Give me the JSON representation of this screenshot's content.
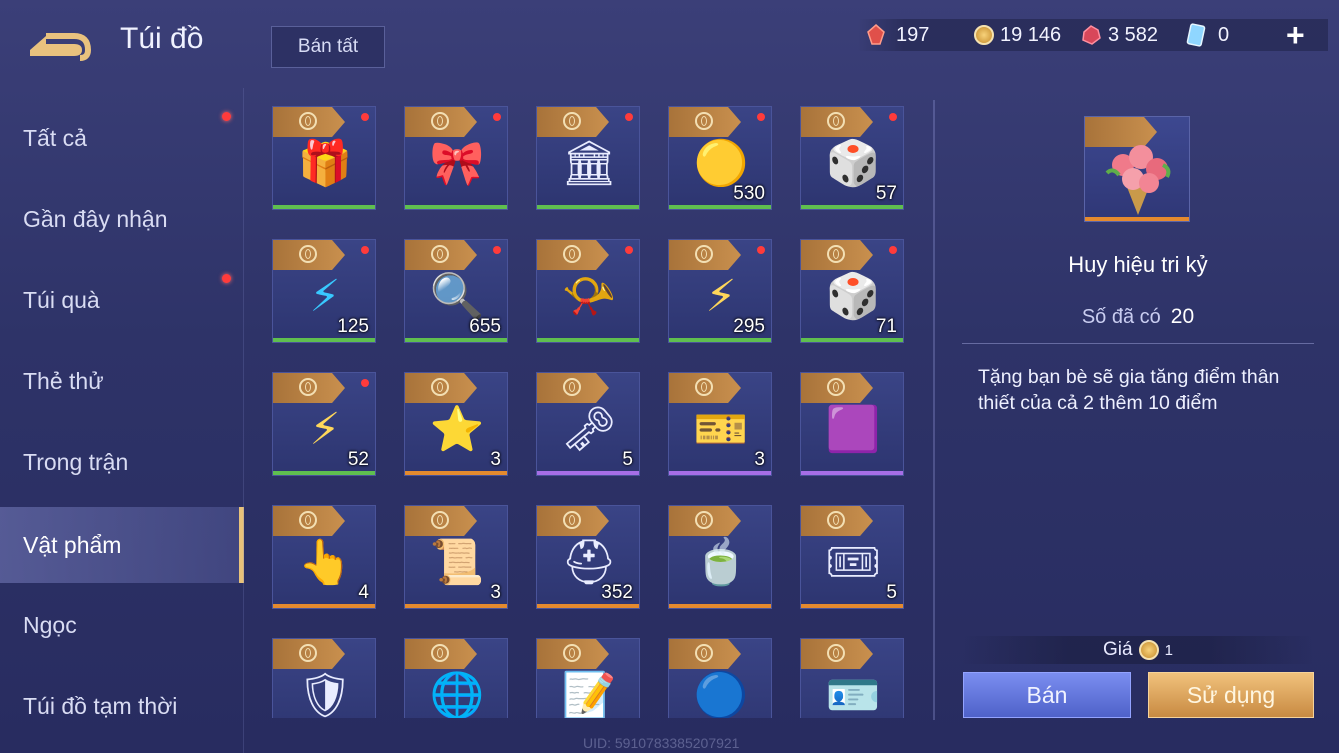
{
  "header": {
    "title": "Túi đồ",
    "sell_all": "Bán tất"
  },
  "currencies": [
    {
      "icon": "red-gem-icon",
      "value": "197"
    },
    {
      "icon": "gold-coin-icon",
      "value": "19 146"
    },
    {
      "icon": "ruby-icon",
      "value": "3 582"
    },
    {
      "icon": "blue-voucher-icon",
      "value": "0"
    }
  ],
  "sidebar": {
    "items": [
      {
        "label": "Tất cả",
        "dot": true
      },
      {
        "label": "Gần đây nhận",
        "dot": false
      },
      {
        "label": "Túi quà",
        "dot": true
      },
      {
        "label": "Thẻ thử",
        "dot": false
      },
      {
        "label": "Trong trận",
        "dot": false
      },
      {
        "label": "Vật phẩm",
        "dot": false,
        "active": true
      },
      {
        "label": "Ngọc",
        "dot": false
      },
      {
        "label": "Túi đồ tạm thời",
        "dot": false
      }
    ]
  },
  "items": [
    {
      "icon": "red-gift-box-icon",
      "qty": "",
      "dot": true,
      "rarity": "green"
    },
    {
      "icon": "ribbon-orb-icon",
      "qty": "",
      "dot": true,
      "rarity": "green"
    },
    {
      "icon": "stage-platform-icon",
      "qty": "",
      "dot": true,
      "rarity": "green"
    },
    {
      "icon": "gold-orb-icon",
      "qty": "530",
      "dot": true,
      "rarity": "green"
    },
    {
      "icon": "blue-dice-icon",
      "qty": "57",
      "dot": true,
      "rarity": "green"
    },
    {
      "icon": "blue-lightning-icon",
      "qty": "125",
      "dot": true,
      "rarity": "green"
    },
    {
      "icon": "magnifier-icon",
      "qty": "655",
      "dot": true,
      "rarity": "green"
    },
    {
      "icon": "whistle-icon",
      "qty": "",
      "dot": true,
      "rarity": "green"
    },
    {
      "icon": "gold-lightning-icon",
      "qty": "295",
      "dot": true,
      "rarity": "green"
    },
    {
      "icon": "purple-dice-icon",
      "qty": "71",
      "dot": true,
      "rarity": "green"
    },
    {
      "icon": "gold-lightning-icon",
      "qty": "52",
      "dot": true,
      "rarity": "green"
    },
    {
      "icon": "star-ticket-icon",
      "qty": "3",
      "dot": false,
      "rarity": "orange"
    },
    {
      "icon": "crest-key-icon",
      "qty": "5",
      "dot": false,
      "rarity": "purple"
    },
    {
      "icon": "double-exp-card-icon",
      "qty": "3",
      "dot": false,
      "rarity": "purple"
    },
    {
      "icon": "purple-card-icon",
      "qty": "",
      "dot": false,
      "rarity": "purple"
    },
    {
      "icon": "tap-hand-icon",
      "qty": "4",
      "dot": false,
      "rarity": "orange"
    },
    {
      "icon": "scroll-map-icon",
      "qty": "3",
      "dot": false,
      "rarity": "orange"
    },
    {
      "icon": "knight-helmet-icon",
      "qty": "352",
      "dot": false,
      "rarity": "orange"
    },
    {
      "icon": "tea-cup-icon",
      "qty": "",
      "dot": false,
      "rarity": "orange"
    },
    {
      "icon": "anniversary-ticket-icon",
      "qty": "5",
      "dot": false,
      "rarity": "orange"
    },
    {
      "icon": "armor-card-icon",
      "qty": "",
      "dot": false,
      "rarity": "orange"
    },
    {
      "icon": "globe-orb-icon",
      "qty": "",
      "dot": false,
      "rarity": "orange"
    },
    {
      "icon": "notes-icon",
      "qty": "",
      "dot": false,
      "rarity": "orange"
    },
    {
      "icon": "tt3-badge-icon",
      "qty": "",
      "dot": false,
      "rarity": "orange"
    },
    {
      "icon": "id-card-icon",
      "qty": "",
      "dot": false,
      "rarity": "orange"
    }
  ],
  "detail": {
    "icon": "rose-bouquet-icon",
    "name": "Huy hiệu tri kỷ",
    "owned_label": "Số đã có",
    "owned_value": "20",
    "description": "Tặng bạn bè sẽ gia tăng điểm thân thiết của cả 2 thêm 10 điểm",
    "price_label": "Giá",
    "price_value": "1",
    "sell_button": "Bán",
    "use_button": "Sử dụng"
  },
  "uid": "UID: 5910783385207921"
}
